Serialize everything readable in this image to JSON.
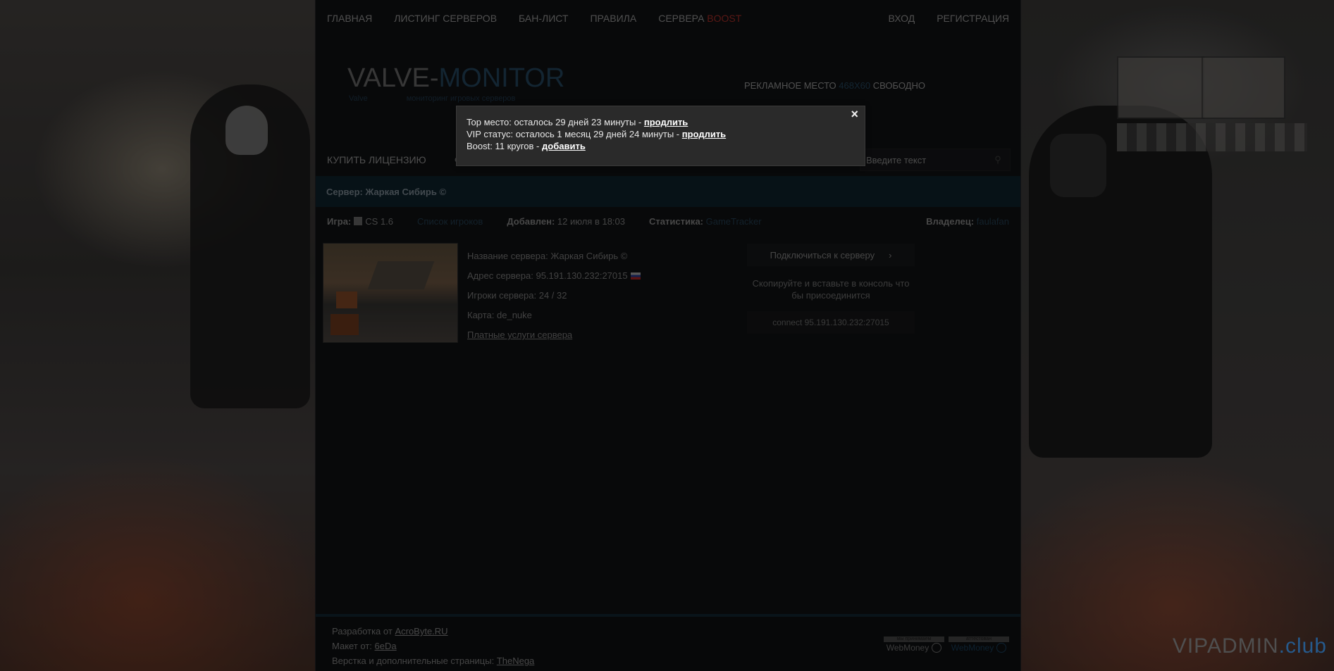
{
  "top_nav": {
    "left": [
      "ГЛАВНАЯ",
      "ЛИСТИНГ СЕРВЕРОВ",
      "БАН-ЛИСТ",
      "ПРАВИЛА"
    ],
    "servers_label": "СЕРВЕРА",
    "boost_label": "BOOST",
    "login": "ВХОД",
    "register": "РЕГИСТРАЦИЯ"
  },
  "logo": {
    "part1": "VALVE-",
    "part2": "MONITOR",
    "sub1": "Valve",
    "sub2": "мониторинг игровых серверов"
  },
  "ad": {
    "prefix": "РЕКЛАМНОЕ МЕСТО",
    "size": "468X60",
    "suffix": "СВОБОДНО"
  },
  "sec_nav": {
    "buy_license": "КУПИТЬ ЛИЦЕНЗИЮ",
    "forum_partial": "ФО"
  },
  "search": {
    "placeholder": "Введите текст",
    "icon": "search-icon"
  },
  "server_title": "Сервер: Жаркая Сибирь ©",
  "meta": {
    "game_label": "Игра:",
    "game_value": "CS 1.6",
    "players_list": "Список игроков",
    "added_label": "Добавлен:",
    "added_value": "12 июля в 18:03",
    "stats_label": "Статистика:",
    "stats_value": "GameTracker",
    "owner_label": "Владелец:",
    "owner_value": "faulafan"
  },
  "server_info": {
    "name": "Название сервера: Жаркая Сибирь ©",
    "address": "Адрес сервера: 95.191.130.232:27015",
    "players": "Игроки сервера: 24 / 32",
    "map": "Карта: de_nuke",
    "paid_services": "Платные услуги сервера"
  },
  "connect": {
    "button": "Подключиться к серверу",
    "chevron": "›",
    "hint": "Скопируйте и вставьте в консоль что бы присоединится",
    "command": "connect 95.191.130.232:27015"
  },
  "footer": {
    "dev_prefix": "Разработка от",
    "dev_link": "AcroByte.RU",
    "layout_prefix": "Макет от:",
    "layout_link": "6eDa",
    "markup_prefix": "Верстка и дополнительные страницы:",
    "markup_link": "TheNega",
    "badge1_top": "мы принимаем",
    "badge1_bottom": "WebMoney",
    "badge2_top": "аттестован",
    "badge2_bottom": "WebMoney"
  },
  "popup": {
    "line1_text": "Top место: осталось 29 дней 23 минуты -",
    "line1_link": "продлить",
    "line2_text": "VIP статус: осталось 1 месяц 29 дней 24 минуты -",
    "line2_link": "продлить",
    "line3_text": "Boost: 11 кругов -",
    "line3_link": "добавить",
    "close": "×"
  },
  "watermark": {
    "main": "VIPADMIN",
    "suffix": ".club"
  },
  "colors": {
    "boost": "#8b2621",
    "accent_blue": "#1e3a4d",
    "watermark_club": "#3b8ad8",
    "popup_bg": "#2a2a2a"
  }
}
